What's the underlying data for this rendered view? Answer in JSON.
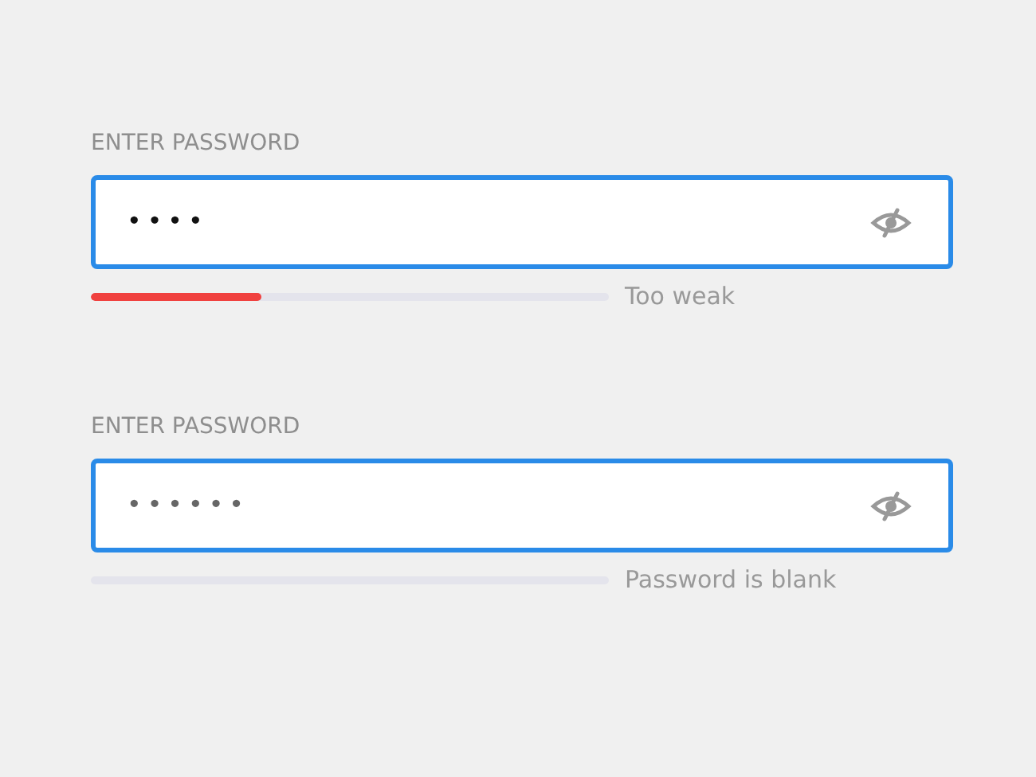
{
  "password_fields": [
    {
      "label": "ENTER PASSWORD",
      "value": "• • • •",
      "strength": {
        "level": 0.33,
        "reading": "Too weak"
      }
    },
    {
      "label": "ENTER PASSWORD",
      "placeholder": "• • • • • •",
      "strength": {
        "reading": "Password is blank"
      }
    }
  ]
}
